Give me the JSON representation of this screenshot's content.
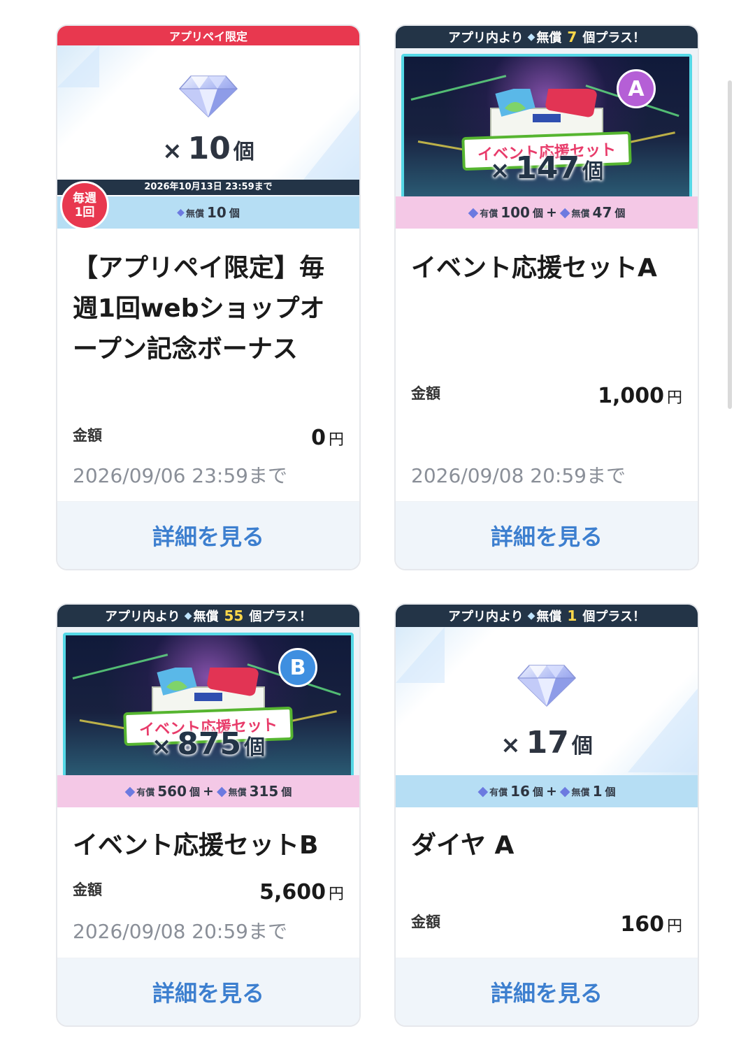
{
  "cards": [
    {
      "banner_top": "アプリペイ限定",
      "quantity": {
        "x": "×",
        "num": "10",
        "unit": "個"
      },
      "weekly_badge": {
        "line1": "毎週",
        "line2": "1回"
      },
      "banner_deadline": "2026年10月13日 23:59まで",
      "sub": {
        "tag_free": "無償",
        "free": "10",
        "unit": "個"
      },
      "title": "【アプリペイ限定】毎週1回webショップオープン記念ボーナス",
      "price_label": "金額",
      "price": "0",
      "yen": "円",
      "deadline": "2026/09/06 23:59まで",
      "button": "詳細を見る"
    },
    {
      "banner_top": {
        "prefix": "アプリ内より",
        "tag": "無償",
        "num": "7",
        "suffix": "個プラス！"
      },
      "set_label": "イベント応援セット",
      "badge": "A",
      "quantity": {
        "x": "×",
        "num": "147",
        "unit": "個"
      },
      "sub": {
        "tag_paid": "有償",
        "paid": "100",
        "tag_free": "無償",
        "free": "47",
        "unit": "個",
        "plus": "+"
      },
      "title": "イベント応援セットA",
      "price_label": "金額",
      "price": "1,000",
      "yen": "円",
      "deadline": "2026/09/08 20:59まで",
      "button": "詳細を見る"
    },
    {
      "banner_top": {
        "prefix": "アプリ内より",
        "tag": "無償",
        "num": "55",
        "suffix": "個プラス！"
      },
      "set_label": "イベント応援セット",
      "badge": "B",
      "quantity": {
        "x": "×",
        "num": "875",
        "unit": "個"
      },
      "sub": {
        "tag_paid": "有償",
        "paid": "560",
        "tag_free": "無償",
        "free": "315",
        "unit": "個",
        "plus": "+"
      },
      "title": "イベント応援セットB",
      "price_label": "金額",
      "price": "5,600",
      "yen": "円",
      "deadline": "2026/09/08 20:59まで",
      "button": "詳細を見る"
    },
    {
      "banner_top": {
        "prefix": "アプリ内より",
        "tag": "無償",
        "num": "1",
        "suffix": "個プラス！"
      },
      "quantity": {
        "x": "×",
        "num": "17",
        "unit": "個"
      },
      "sub": {
        "tag_paid": "有償",
        "paid": "16",
        "tag_free": "無償",
        "free": "1",
        "unit": "個",
        "plus": "+"
      },
      "title": "ダイヤ A",
      "price_label": "金額",
      "price": "160",
      "yen": "円",
      "button": "詳細を見る"
    }
  ],
  "icons": {
    "gem": "diamond-icon"
  },
  "colors": {
    "accent_red": "#e8384f",
    "navy": "#233447",
    "link_blue": "#3d7fcf",
    "pink_bar": "#f4c8e6",
    "blue_bar": "#b6def4"
  }
}
